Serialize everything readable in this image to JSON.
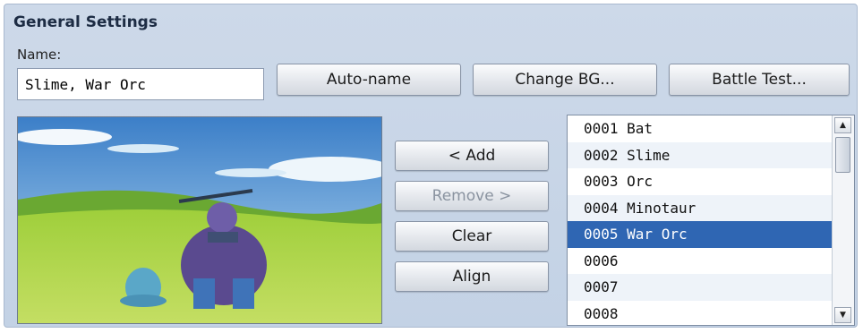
{
  "section": {
    "title": "General Settings"
  },
  "name_field": {
    "label": "Name:",
    "value": "Slime, War Orc"
  },
  "top_buttons": {
    "auto_name": "Auto-name",
    "change_bg": "Change BG...",
    "battle_test": "Battle Test..."
  },
  "middle_buttons": {
    "add": "< Add",
    "remove": "Remove >",
    "clear": "Clear",
    "align": "Align"
  },
  "enemy_list": {
    "items": [
      "0001 Bat",
      "0002 Slime",
      "0003 Orc",
      "0004 Minotaur",
      "0005 War Orc",
      "0006",
      "0007",
      "0008"
    ],
    "selected_index": 4,
    "selected_color": "#2f66b3"
  },
  "icons": {
    "scroll_up": "triangle-up-icon",
    "scroll_down": "triangle-down-icon"
  }
}
